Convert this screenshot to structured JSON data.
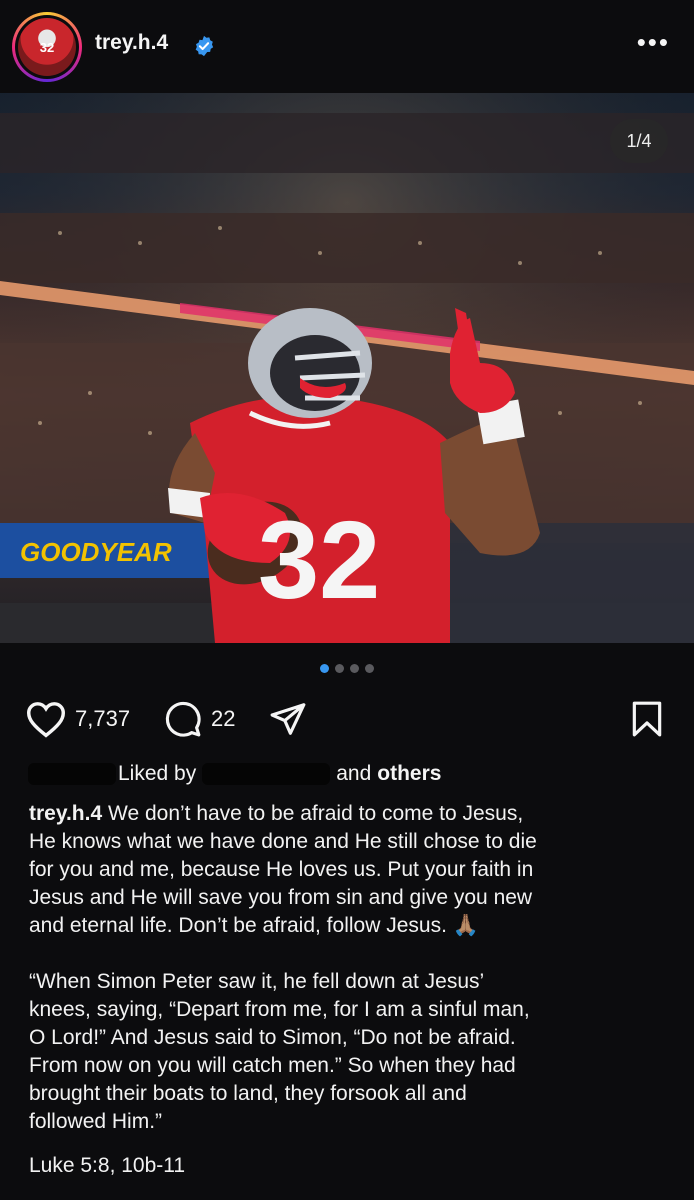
{
  "post": {
    "username": "trey.h.4",
    "avatar_text": "32",
    "page_counter": "1/4",
    "likes": "7,737",
    "comments": "22",
    "liked_by_prefix": "Liked by",
    "liked_by_suffix": "and",
    "liked_by_others": "others",
    "caption_para1": "We don’t have to be afraid to come to Jesus,\nHe knows what we have done and He still chose to die\nfor you and me, because He loves us. Put your faith in\nJesus and He will save you from sin and give you new\nand eternal life. Don’t be afraid, follow Jesus. 🙏🏽",
    "caption_para2": "“When Simon Peter saw it, he fell down at Jesus’\nknees, saying, “Depart from me, for I am a sinful man,\nO Lord!” And Jesus said to Simon, “Do not be afraid.\nFrom now on you will catch men.” So when they had\nbrought their boats to land, they forsook all and\nfollowed Him.”",
    "reference": "Luke 5:8, 10b-11",
    "jersey_number": "32",
    "banner_text": "GOODYEAR"
  },
  "colors": {
    "background": "#0c0c0e",
    "text": "#f5f5f5",
    "verified": "#3897f0",
    "carousel_active": "#3897f0",
    "jersey": "#d3202c"
  },
  "carousel": {
    "count": 4,
    "active_index": 0
  },
  "icons": [
    "heart-icon",
    "comment-icon",
    "share-icon",
    "bookmark-icon",
    "more-icon",
    "verified-badge-icon"
  ]
}
